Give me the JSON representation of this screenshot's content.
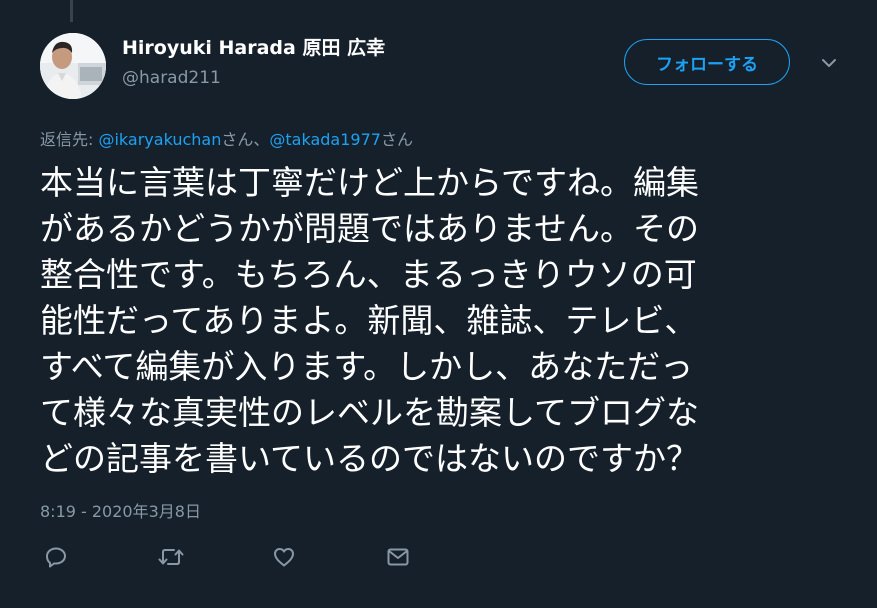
{
  "author": {
    "display_name": "Hiroyuki Harada 原田 広幸",
    "handle": "@harad211"
  },
  "follow_button": {
    "label": "フォローする"
  },
  "reply_context": {
    "prefix": "返信先: ",
    "mention_1": "@ikaryakuchan",
    "separator": "さん、",
    "mention_2": "@takada1977",
    "suffix": "さん"
  },
  "tweet": {
    "lines": [
      "本当に言葉は丁寧だけど上からですね。編集",
      "があるかどうかが問題ではありません。その",
      "整合性です。もちろん、まるっきりウソの可",
      "能性だってありまよ。新聞、雑誌、テレビ、",
      "すべて編集が入ります。しかし、あなただっ",
      "て様々な真実性のレベルを勘案してブログな",
      "どの記事を書いているのではないのですか？"
    ],
    "timestamp": "8:19 - 2020年3月8日"
  },
  "icons": {
    "reply": "reply-icon",
    "retweet": "retweet-icon",
    "like": "heart-icon",
    "dm": "envelope-icon",
    "caret": "chevron-down-icon"
  },
  "colors": {
    "background": "#15202b",
    "accent": "#1da1f2",
    "secondary_text": "#8899a6",
    "primary_text": "#ffffff"
  }
}
